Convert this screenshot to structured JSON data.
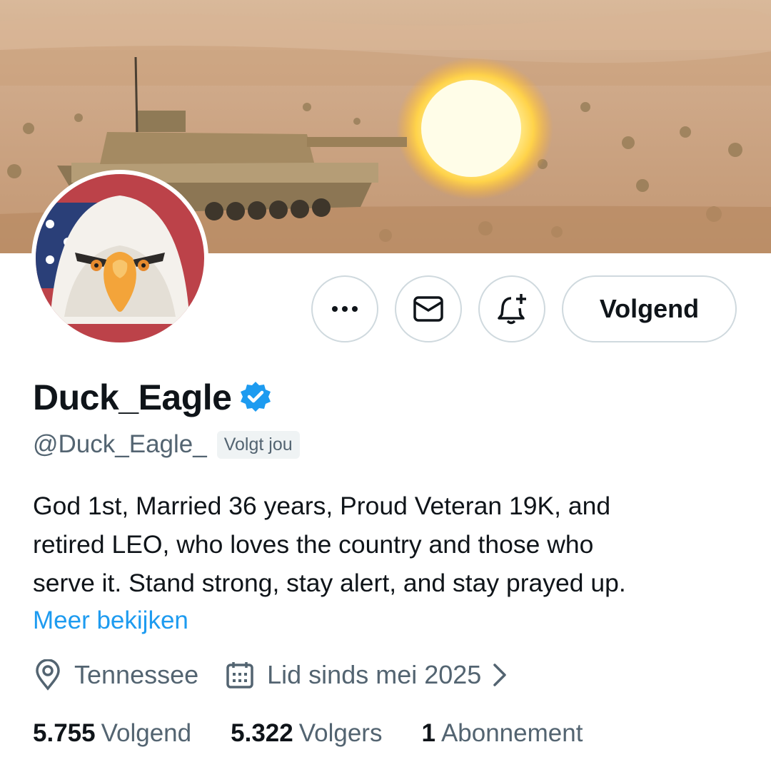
{
  "profile": {
    "display_name": "Duck_Eagle",
    "handle": "@Duck_Eagle_",
    "follows_you_badge": "Volgt jou",
    "verified": true,
    "bio": "God 1st, Married 36 years, Proud Veteran  19K, and\nretired LEO, who loves the country and those who\nserve it. Stand strong, stay alert, and stay prayed up.",
    "more_link": "Meer bekijken",
    "location": "Tennessee",
    "joined": "Lid sinds mei 2025",
    "stats": {
      "following_count": "5.755",
      "following_label": "Volgend",
      "followers_count": "5.322",
      "followers_label": "Volgers",
      "subscriptions_count": "1",
      "subscriptions_label": "Abonnement"
    }
  },
  "actions": {
    "more_icon": "more-dots-icon",
    "message_icon": "envelope-icon",
    "notify_icon": "bell-plus-icon",
    "follow_label": "Volgend"
  },
  "banner": {
    "description_icon": "banner-image"
  },
  "colors": {
    "accent": "#1d9bf0",
    "text_primary": "#0f1419",
    "text_secondary": "#536471",
    "border": "#cfd9de"
  }
}
